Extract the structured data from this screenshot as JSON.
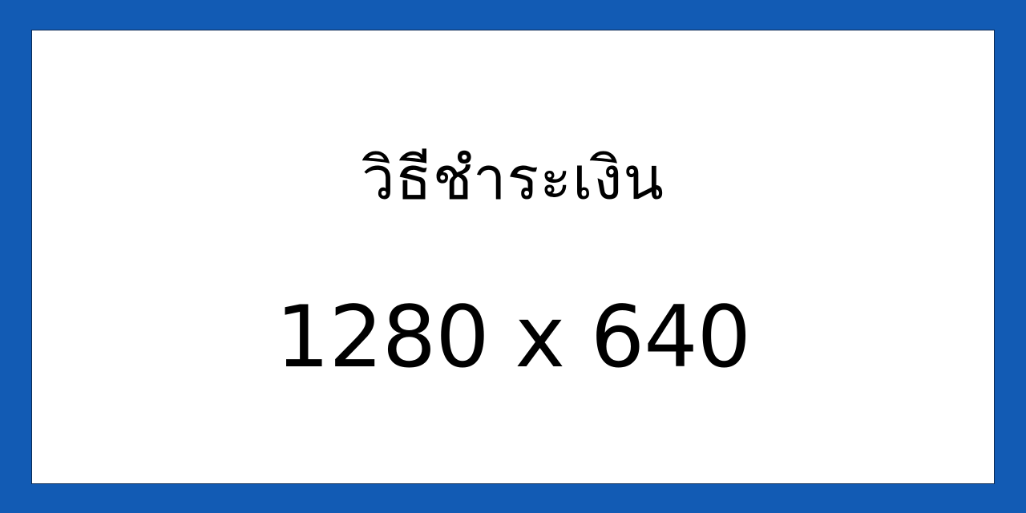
{
  "colors": {
    "frame": "#125bb4",
    "panel": "#ffffff",
    "text": "#000000"
  },
  "card": {
    "title": "วิธีชำระเงิน",
    "dimensions": "1280 x 640"
  }
}
